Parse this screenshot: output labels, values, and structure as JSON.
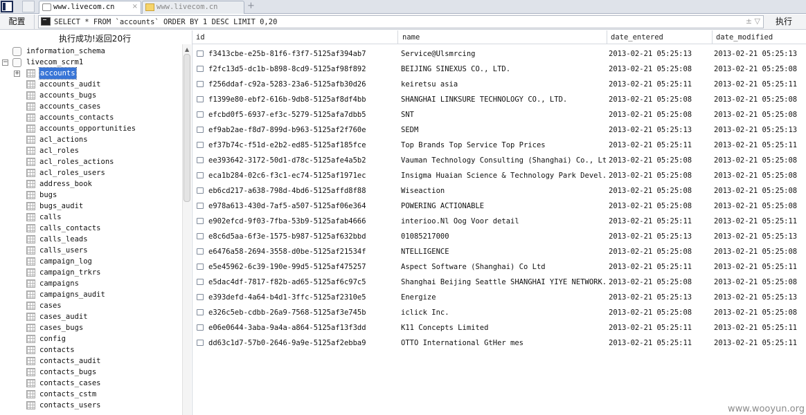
{
  "tabs": [
    {
      "label": "www.livecom.cn",
      "active": true
    },
    {
      "label": "www.livecom.cn",
      "active": false
    }
  ],
  "toolbar": {
    "config_label": "配置",
    "sql_value": "SELECT * FROM `accounts` ORDER BY 1 DESC LIMIT 0,20",
    "sql_arrows": "± ▽",
    "execute_label": "执行"
  },
  "status": "执行成功!返回20行",
  "tree": {
    "databases": [
      "information_schema",
      "livecom_scrm1"
    ],
    "tables": [
      "accounts",
      "accounts_audit",
      "accounts_bugs",
      "accounts_cases",
      "accounts_contacts",
      "accounts_opportunities",
      "acl_actions",
      "acl_roles",
      "acl_roles_actions",
      "acl_roles_users",
      "address_book",
      "bugs",
      "bugs_audit",
      "calls",
      "calls_contacts",
      "calls_leads",
      "calls_users",
      "campaign_log",
      "campaign_trkrs",
      "campaigns",
      "campaigns_audit",
      "cases",
      "cases_audit",
      "cases_bugs",
      "config",
      "contacts",
      "contacts_audit",
      "contacts_bugs",
      "contacts_cases",
      "contacts_cstm",
      "contacts_users"
    ],
    "selected_table": "accounts"
  },
  "grid": {
    "columns": [
      "id",
      "name",
      "date_entered",
      "date_modified"
    ],
    "rows": [
      [
        "f3413cbe-e25b-81f6-f3f7-5125af394ab7",
        "Service@Ulsmrcing",
        "2013-02-21 05:25:13",
        "2013-02-21 05:25:13"
      ],
      [
        "f2fc13d5-dc1b-b898-8cd9-5125af98f892",
        "BEIJING SINEXUS CO., LTD.",
        "2013-02-21 05:25:08",
        "2013-02-21 05:25:08"
      ],
      [
        "f256ddaf-c92a-5283-23a6-5125afb30d26",
        "keiretsu asia",
        "2013-02-21 05:25:11",
        "2013-02-21 05:25:11"
      ],
      [
        "f1399e80-ebf2-616b-9db8-5125af8df4bb",
        "SHANGHAI LINKSURE TECHNOLOGY CO., LTD.",
        "2013-02-21 05:25:08",
        "2013-02-21 05:25:08"
      ],
      [
        "efcbd0f5-6937-ef3c-5279-5125afa7dbb5",
        "SNT",
        "2013-02-21 05:25:08",
        "2013-02-21 05:25:08"
      ],
      [
        "ef9ab2ae-f8d7-899d-b963-5125af2f760e",
        "SEDM",
        "2013-02-21 05:25:13",
        "2013-02-21 05:25:13"
      ],
      [
        "ef37b74c-f51d-e2b2-ed85-5125af185fce",
        "Top Brands Top Service Top Prices",
        "2013-02-21 05:25:11",
        "2013-02-21 05:25:11"
      ],
      [
        "ee393642-3172-50d1-d78c-5125afe4a5b2",
        "Vauman Technology Consulting (Shanghai) Co., Ltd.",
        "2013-02-21 05:25:08",
        "2013-02-21 05:25:08"
      ],
      [
        "eca1b284-02c6-f3c1-ec74-5125af1971ec",
        "Insigma Huaian Science & Technology Park Devel...",
        "2013-02-21 05:25:08",
        "2013-02-21 05:25:08"
      ],
      [
        "eb6cd217-a638-798d-4bd6-5125affd8f88",
        "Wiseaction",
        "2013-02-21 05:25:08",
        "2013-02-21 05:25:08"
      ],
      [
        "e978a613-430d-7af5-a507-5125af06e364",
        "POWERING ACTIONABLE",
        "2013-02-21 05:25:08",
        "2013-02-21 05:25:08"
      ],
      [
        "e902efcd-9f03-7fba-53b9-5125afab4666",
        "interioo.Nl Oog Voor detail",
        "2013-02-21 05:25:11",
        "2013-02-21 05:25:11"
      ],
      [
        "e8c6d5aa-6f3e-1575-b987-5125af632bbd",
        "01085217000",
        "2013-02-21 05:25:13",
        "2013-02-21 05:25:13"
      ],
      [
        "e6476a58-2694-3558-d0be-5125af21534f",
        "NTELLIGENCE",
        "2013-02-21 05:25:08",
        "2013-02-21 05:25:08"
      ],
      [
        "e5e45962-6c39-190e-99d5-5125af475257",
        "Aspect Software (Shanghai) Co Ltd",
        "2013-02-21 05:25:11",
        "2013-02-21 05:25:11"
      ],
      [
        "e5dac4df-7817-f82b-ad65-5125af6c97c5",
        "Shanghai Beijing Seattle SHANGHAI YIYE NETWORK...",
        "2013-02-21 05:25:08",
        "2013-02-21 05:25:08"
      ],
      [
        "e393defd-4a64-b4d1-3ffc-5125af2310e5",
        "Energize",
        "2013-02-21 05:25:13",
        "2013-02-21 05:25:13"
      ],
      [
        "e326c5eb-cdbb-26a9-7568-5125af3e745b",
        "iclick Inc.",
        "2013-02-21 05:25:08",
        "2013-02-21 05:25:08"
      ],
      [
        "e06e0644-3aba-9a4a-a864-5125af13f3dd",
        "K11 Concepts Limited",
        "2013-02-21 05:25:11",
        "2013-02-21 05:25:11"
      ],
      [
        "dd63c1d7-57b0-2646-9a9e-5125af2ebba9",
        "OTTO International GtHer mes",
        "2013-02-21 05:25:11",
        "2013-02-21 05:25:11"
      ]
    ]
  },
  "watermark": "www.wooyun.org"
}
